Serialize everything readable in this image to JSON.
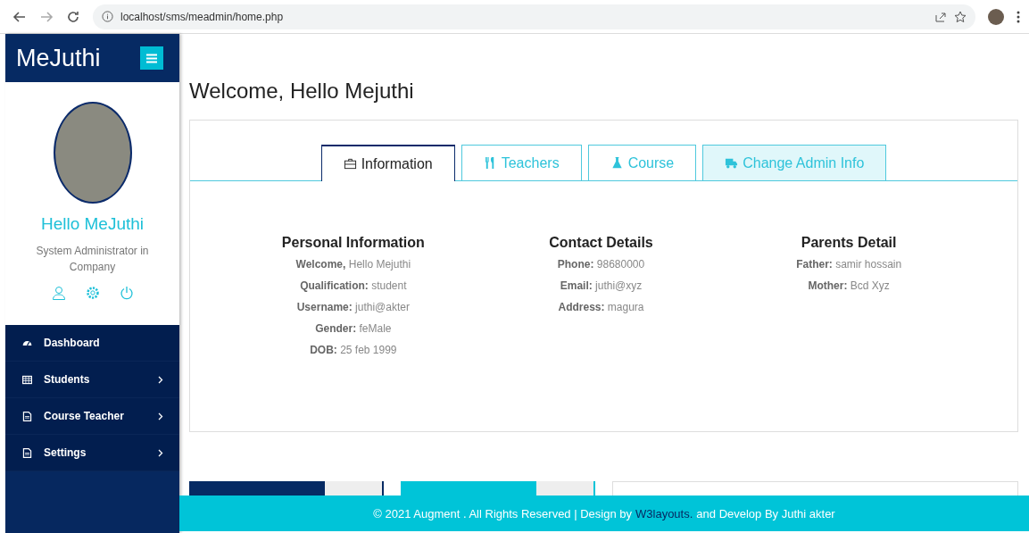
{
  "browser": {
    "url": "localhost/sms/meadmin/home.php"
  },
  "sidebar": {
    "brand": "MeJuthi",
    "greeting": "Hello MeJuthi",
    "role": "System Administrator in Company",
    "menu": [
      {
        "label": "Dashboard",
        "expandable": false
      },
      {
        "label": "Students",
        "expandable": true
      },
      {
        "label": "Course Teacher",
        "expandable": true
      },
      {
        "label": "Settings",
        "expandable": true
      }
    ]
  },
  "page_title": "Welcome, Hello Mejuthi",
  "tabs": [
    {
      "label": "Information",
      "selected": true,
      "hovered": false
    },
    {
      "label": "Teachers",
      "selected": false,
      "hovered": false
    },
    {
      "label": "Course",
      "selected": false,
      "hovered": false
    },
    {
      "label": "Change Admin Info",
      "selected": false,
      "hovered": true
    }
  ],
  "sections": [
    {
      "title": "Personal Information",
      "lines": [
        "**Welcome,** Hello Mejuthi",
        "**Qualification:** student",
        "**Username:** juthi@akter",
        "**Gender:** feMale",
        "**DOB:** 25 feb 1999"
      ]
    },
    {
      "title": "Contact Details",
      "lines": [
        "**Phone:** 98680000",
        "**Email:** juthi@xyz",
        "**Address:** magura"
      ]
    },
    {
      "title": "Parents Detail",
      "lines": [
        "**Father:** samir hossain",
        "**Mother:** Bcd Xyz"
      ]
    }
  ],
  "footer": {
    "text": "© 2021 Augment . All Rights Reserved | Design by",
    "link": "W3layouts.",
    "after": "and Develop By Juthi akter"
  }
}
